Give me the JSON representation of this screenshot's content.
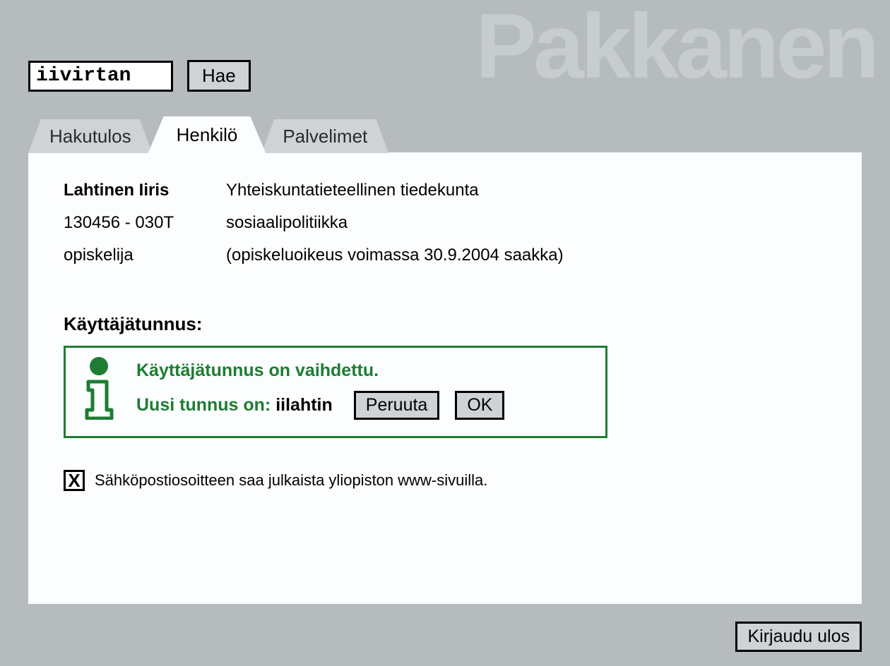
{
  "brand": "Pakkanen",
  "search": {
    "value": "iivirtan",
    "button": "Hae"
  },
  "tabs": {
    "results": "Hakutulos",
    "person": "Henkilö",
    "servers": "Palvelimet"
  },
  "person": {
    "name": "Lahtinen Iiris",
    "faculty": "Yhteiskuntatieteellinen tiedekunta",
    "id": "130456 - 030T",
    "subject": "sosiaalipolitiikka",
    "role": "opiskelija",
    "validity": "(opiskeluoikeus voimassa 30.9.2004 saakka)"
  },
  "username": {
    "label": "Käyttäjätunnus:",
    "changed_msg": "Käyttäjätunnus on vaihdettu.",
    "new_label": "Uusi tunnus on: ",
    "new_value": "iilahtin",
    "cancel": "Peruuta",
    "ok": "OK"
  },
  "publish": {
    "checked_glyph": "X",
    "text": "Sähköpostiosoitteen saa julkaista yliopiston www-sivuilla."
  },
  "logout": "Kirjaudu ulos"
}
